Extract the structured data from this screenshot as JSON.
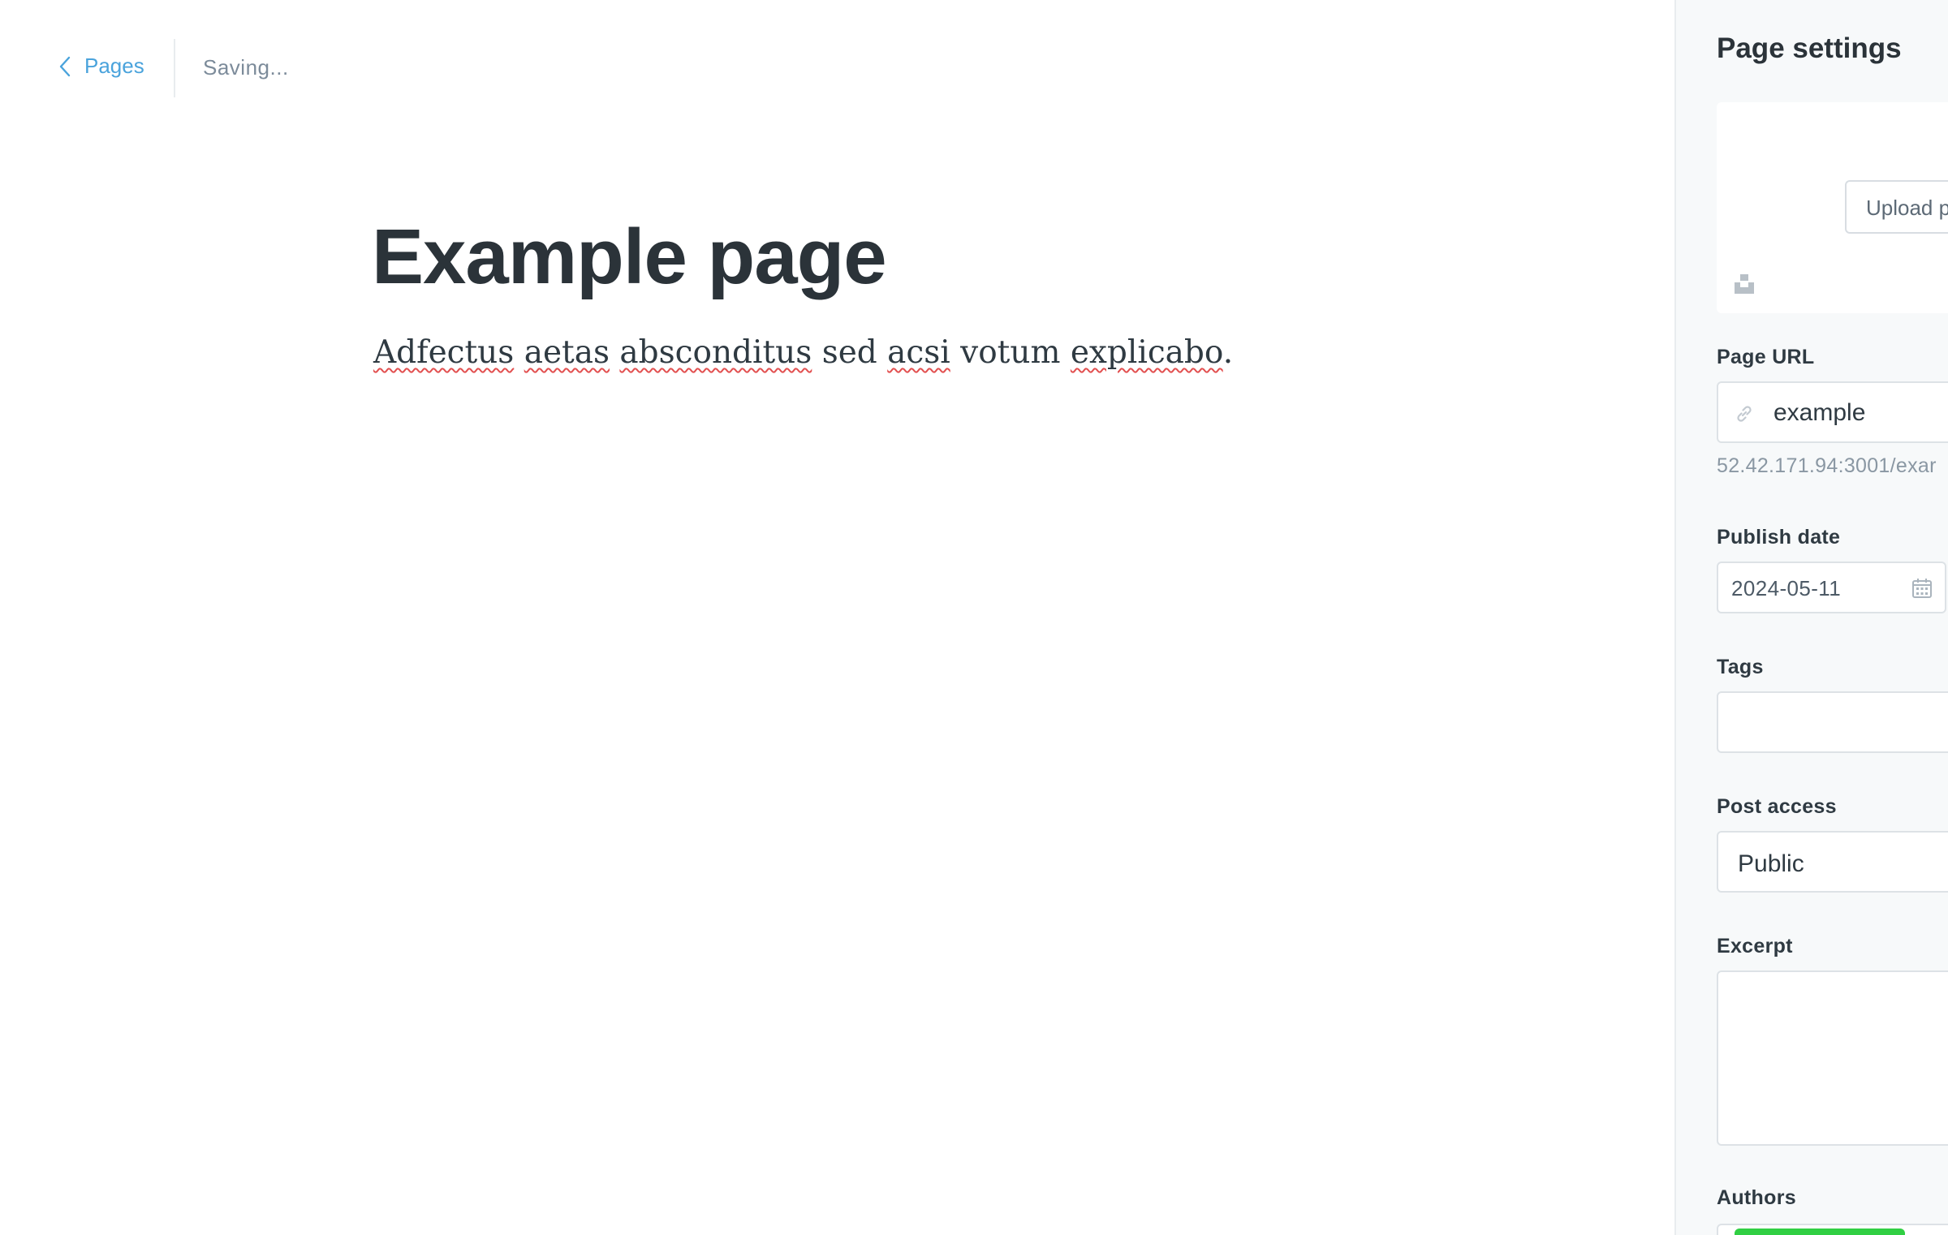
{
  "header": {
    "back_label": "Pages",
    "status": "Saving..."
  },
  "editor": {
    "title": "Example page",
    "body_words": [
      "Adfectus",
      " ",
      "aetas",
      " ",
      "absconditus",
      " sed ",
      "acsi",
      " votum ",
      "explicabo",
      "."
    ]
  },
  "settings": {
    "title": "Page settings",
    "image": {
      "upload_label": "Upload p"
    },
    "url": {
      "label": "Page URL",
      "value": "example",
      "hint": "52.42.171.94:3001/exar"
    },
    "publish_date": {
      "label": "Publish date",
      "value": "2024-05-11"
    },
    "tags": {
      "label": "Tags"
    },
    "access": {
      "label": "Post access",
      "value": "Public"
    },
    "excerpt": {
      "label": "Excerpt"
    },
    "authors": {
      "label": "Authors"
    }
  },
  "colors": {
    "link": "#4aa3dc",
    "spellcheck": "#e25050",
    "author_chip": "#30cf43"
  }
}
